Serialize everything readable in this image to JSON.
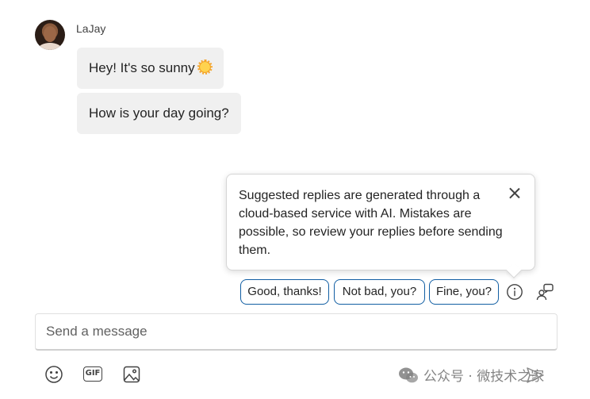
{
  "conversation": {
    "sender_name": "LaJay",
    "messages": [
      {
        "text": "Hey! It's so sunny",
        "emoji": "sun-emoji"
      },
      {
        "text": "How is your day going?"
      }
    ]
  },
  "tooltip": {
    "text": "Suggested replies are generated through a cloud-based service with AI. Mistakes are possible, so review your replies before sending them.",
    "close_icon": "close-icon"
  },
  "suggested_replies": [
    "Good, thanks!",
    "Not bad, you?",
    "Fine, you?"
  ],
  "suggestion_actions": {
    "info_icon": "info-icon",
    "feedback_icon": "people-feedback-icon"
  },
  "compose": {
    "placeholder": "Send a message",
    "value": ""
  },
  "toolbar": {
    "emoji_icon": "emoji-icon",
    "gif_label": "GIF",
    "image_icon": "image-icon",
    "send_icon": "send-icon"
  },
  "watermark": {
    "text": "公众号 · 微技术之家"
  },
  "colors": {
    "chip_border": "#115ea3",
    "bubble_bg": "#f0f0f0",
    "text": "#242424"
  }
}
